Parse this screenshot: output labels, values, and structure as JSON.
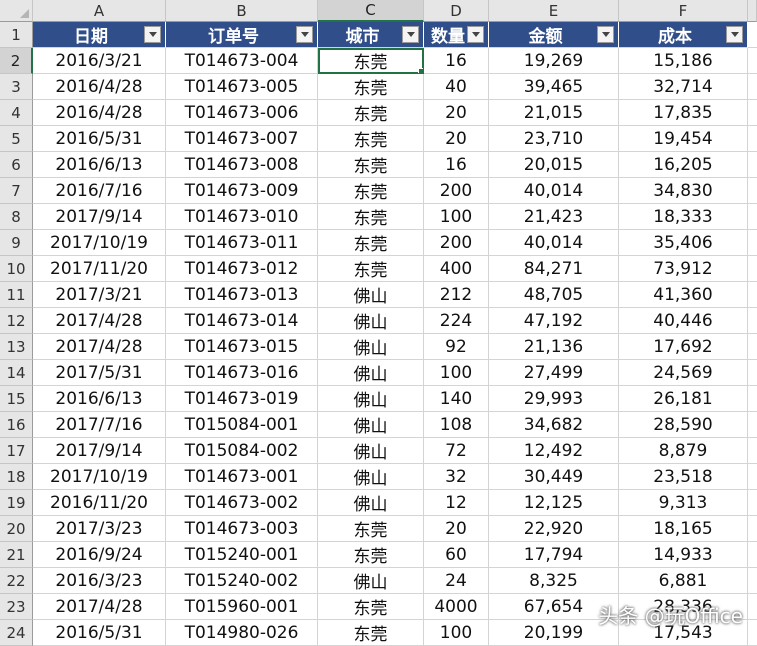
{
  "columns": [
    "A",
    "B",
    "C",
    "D",
    "E",
    "F"
  ],
  "header_row_number": "1",
  "headers": [
    "日期",
    "订单号",
    "城市",
    "数量",
    "金额",
    "成本"
  ],
  "rows": [
    {
      "n": "2",
      "date": "2016/3/21",
      "order": "T014673-004",
      "city": "东莞",
      "qty": "16",
      "amount": "19,269",
      "cost": "15,186"
    },
    {
      "n": "3",
      "date": "2016/4/28",
      "order": "T014673-005",
      "city": "东莞",
      "qty": "40",
      "amount": "39,465",
      "cost": "32,714"
    },
    {
      "n": "4",
      "date": "2016/4/28",
      "order": "T014673-006",
      "city": "东莞",
      "qty": "20",
      "amount": "21,015",
      "cost": "17,835"
    },
    {
      "n": "5",
      "date": "2016/5/31",
      "order": "T014673-007",
      "city": "东莞",
      "qty": "20",
      "amount": "23,710",
      "cost": "19,454"
    },
    {
      "n": "6",
      "date": "2016/6/13",
      "order": "T014673-008",
      "city": "东莞",
      "qty": "16",
      "amount": "20,015",
      "cost": "16,205"
    },
    {
      "n": "7",
      "date": "2016/7/16",
      "order": "T014673-009",
      "city": "东莞",
      "qty": "200",
      "amount": "40,014",
      "cost": "34,830"
    },
    {
      "n": "8",
      "date": "2017/9/14",
      "order": "T014673-010",
      "city": "东莞",
      "qty": "100",
      "amount": "21,423",
      "cost": "18,333"
    },
    {
      "n": "9",
      "date": "2017/10/19",
      "order": "T014673-011",
      "city": "东莞",
      "qty": "200",
      "amount": "40,014",
      "cost": "35,406"
    },
    {
      "n": "10",
      "date": "2017/11/20",
      "order": "T014673-012",
      "city": "东莞",
      "qty": "400",
      "amount": "84,271",
      "cost": "73,912"
    },
    {
      "n": "11",
      "date": "2017/3/21",
      "order": "T014673-013",
      "city": "佛山",
      "qty": "212",
      "amount": "48,705",
      "cost": "41,360"
    },
    {
      "n": "12",
      "date": "2017/4/28",
      "order": "T014673-014",
      "city": "佛山",
      "qty": "224",
      "amount": "47,192",
      "cost": "40,446"
    },
    {
      "n": "13",
      "date": "2017/4/28",
      "order": "T014673-015",
      "city": "佛山",
      "qty": "92",
      "amount": "21,136",
      "cost": "17,692"
    },
    {
      "n": "14",
      "date": "2017/5/31",
      "order": "T014673-016",
      "city": "佛山",
      "qty": "100",
      "amount": "27,499",
      "cost": "24,569"
    },
    {
      "n": "15",
      "date": "2016/6/13",
      "order": "T014673-019",
      "city": "佛山",
      "qty": "140",
      "amount": "29,993",
      "cost": "26,181"
    },
    {
      "n": "16",
      "date": "2017/7/16",
      "order": "T015084-001",
      "city": "佛山",
      "qty": "108",
      "amount": "34,682",
      "cost": "28,590"
    },
    {
      "n": "17",
      "date": "2017/9/14",
      "order": "T015084-002",
      "city": "佛山",
      "qty": "72",
      "amount": "12,492",
      "cost": "8,879"
    },
    {
      "n": "18",
      "date": "2017/10/19",
      "order": "T014673-001",
      "city": "佛山",
      "qty": "32",
      "amount": "30,449",
      "cost": "23,518"
    },
    {
      "n": "19",
      "date": "2016/11/20",
      "order": "T014673-002",
      "city": "佛山",
      "qty": "12",
      "amount": "12,125",
      "cost": "9,313"
    },
    {
      "n": "20",
      "date": "2017/3/23",
      "order": "T014673-003",
      "city": "东莞",
      "qty": "20",
      "amount": "22,920",
      "cost": "18,165"
    },
    {
      "n": "21",
      "date": "2016/9/24",
      "order": "T015240-001",
      "city": "东莞",
      "qty": "60",
      "amount": "17,794",
      "cost": "14,933"
    },
    {
      "n": "22",
      "date": "2016/3/23",
      "order": "T015240-002",
      "city": "佛山",
      "qty": "24",
      "amount": "8,325",
      "cost": "6,881"
    },
    {
      "n": "23",
      "date": "2017/4/28",
      "order": "T015960-001",
      "city": "东莞",
      "qty": "4000",
      "amount": "67,654",
      "cost": "28,336"
    },
    {
      "n": "24",
      "date": "2016/5/31",
      "order": "T014980-026",
      "city": "东莞",
      "qty": "100",
      "amount": "20,199",
      "cost": "17,543"
    }
  ],
  "watermark": "头条 @玩Office",
  "colors": {
    "header_bg": "#2f4e8a",
    "selection": "#217346"
  }
}
